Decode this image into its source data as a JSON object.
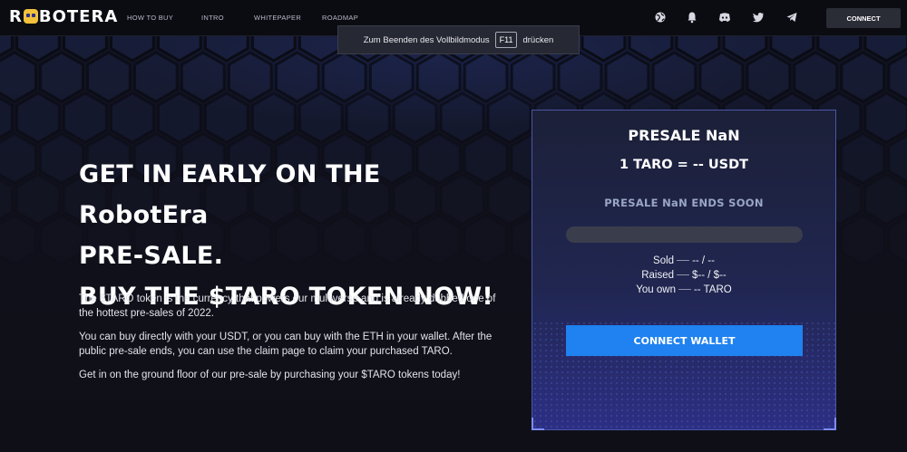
{
  "brand": {
    "logo_text_left": "R",
    "logo_text_right": "BOTERA"
  },
  "nav": {
    "links": [
      "HOW TO BUY",
      "INTRO",
      "WHITEPAPER",
      "ROADMAP"
    ],
    "icons": [
      "globe-icon",
      "bell-icon",
      "discord-icon",
      "twitter-icon",
      "telegram-icon"
    ],
    "connect_label": "CONNECT"
  },
  "fullscreen_tip": {
    "before": "Zum Beenden des Vollbildmodus",
    "key": "F11",
    "after": "drücken"
  },
  "hero": {
    "headline_lines": [
      "GET IN EARLY ON THE RobotEra",
      "PRE-SALE.",
      "BUY THE $TARO TOKEN NOW!"
    ],
    "paragraphs": [
      "The $TARO token is the currency that powers our multiverse and is already dubbed one of the hottest pre-sales of 2022.",
      "You can buy directly with your USDT, or you can buy with the ETH in your wallet. After the public pre-sale ends, you can use the claim page to claim your purchased TARO.",
      "Get in on the ground floor of our pre-sale by purchasing your $TARO tokens today!"
    ]
  },
  "presale": {
    "title": "PRESALE NaN",
    "rate": "1 TARO = -- USDT",
    "ends_text": "PRESALE NaN ENDS SOON",
    "progress_fraction": 0,
    "sold_label": "Sold",
    "sold_value": "-- / --",
    "raised_label": "Raised",
    "raised_value": "$-- / $--",
    "own_label": "You own",
    "own_value": "-- TARO",
    "wallet_button": "CONNECT WALLET"
  },
  "colors": {
    "accent_blue": "#1f82f0",
    "card_border": "#4b56a8",
    "logo_yellow": "#f2c23b"
  }
}
